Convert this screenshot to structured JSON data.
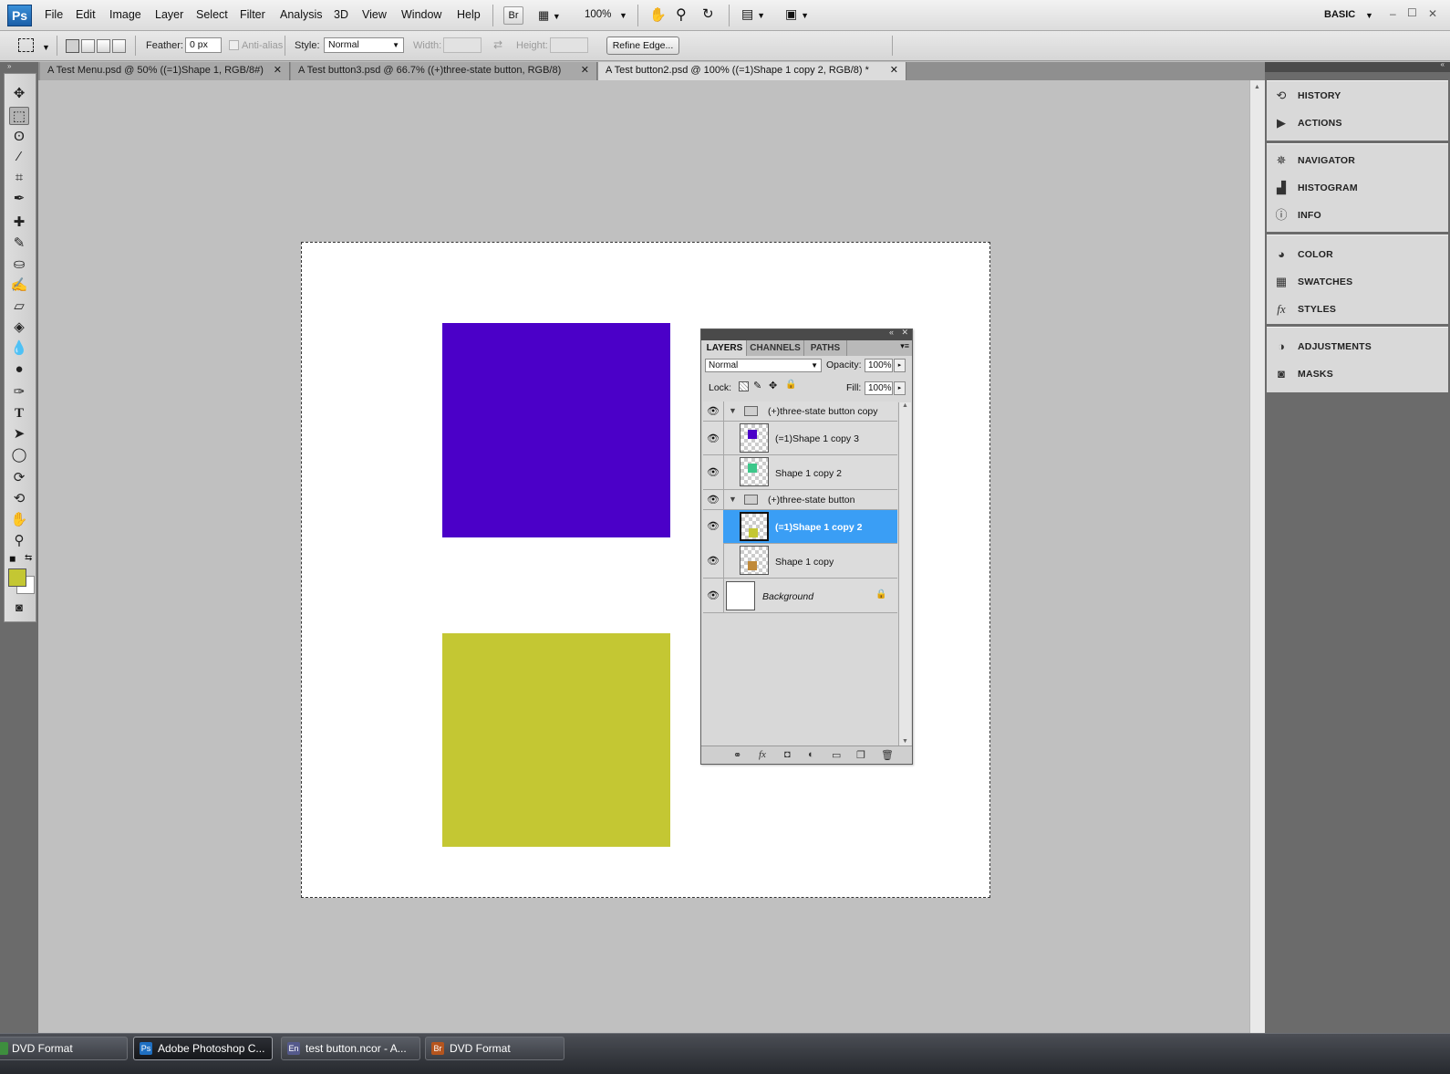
{
  "menubar": {
    "logo": "Ps",
    "menus": [
      "File",
      "Edit",
      "Image",
      "Layer",
      "Select",
      "Filter",
      "Analysis",
      "3D",
      "View",
      "Window",
      "Help"
    ],
    "bridge_label": "Br",
    "zoom": "100%",
    "workspace": "BASIC",
    "window_controls": [
      "–",
      "☐",
      "✕"
    ]
  },
  "options": {
    "feather_label": "Feather:",
    "feather_value": "0 px",
    "antialias_label": "Anti-alias",
    "style_label": "Style:",
    "style_value": "Normal",
    "width_label": "Width:",
    "height_label": "Height:",
    "refine_edge": "Refine Edge..."
  },
  "tabs": [
    {
      "label": "A Test Menu.psd @ 50% ((=1)Shape 1, RGB/8#)",
      "active": false
    },
    {
      "label": "A Test button3.psd @ 66.7% ((+)three-state button, RGB/8)",
      "active": false
    },
    {
      "label": "A Test button2.psd @ 100% ((=1)Shape 1 copy 2, RGB/8) *",
      "active": true
    }
  ],
  "canvas": {
    "square_top_color": "#4b00c8",
    "square_bottom_color": "#c4c733"
  },
  "toolbox": {
    "foreground_color": "#c4c733",
    "background_color": "#ffffff"
  },
  "layers_panel": {
    "tabs": [
      "LAYERS",
      "CHANNELS",
      "PATHS"
    ],
    "blend_mode": "Normal",
    "opacity_label": "Opacity:",
    "opacity_value": "100%",
    "lock_label": "Lock:",
    "fill_label": "Fill:",
    "fill_value": "100%",
    "layers": [
      {
        "name": "(+)three-state button copy",
        "type": "group"
      },
      {
        "name": "(=1)Shape 1 copy 3",
        "type": "layer",
        "color": "#4b00c8"
      },
      {
        "name": "Shape 1 copy 2",
        "type": "layer",
        "color": "#3cc78a"
      },
      {
        "name": "(+)three-state button",
        "type": "group"
      },
      {
        "name": "(=1)Shape 1 copy 2",
        "type": "layer",
        "color": "#c4c733",
        "selected": true
      },
      {
        "name": "Shape 1 copy",
        "type": "layer",
        "color": "#c08a3a"
      },
      {
        "name": "Background",
        "type": "background"
      }
    ],
    "bottom_icons": [
      "link-icon",
      "fx-icon",
      "mask-icon",
      "adjustment-icon",
      "folder-icon",
      "new-layer-icon",
      "trash-icon"
    ]
  },
  "dock": {
    "groups": [
      [
        "HISTORY",
        "ACTIONS"
      ],
      [
        "NAVIGATOR",
        "HISTOGRAM",
        "INFO"
      ],
      [
        "COLOR",
        "SWATCHES",
        "STYLES"
      ],
      [
        "ADJUSTMENTS",
        "MASKS"
      ]
    ]
  },
  "taskbar": {
    "items": [
      {
        "label": "DVD Format",
        "icon": "dvd-icon",
        "active": false
      },
      {
        "label": "Adobe Photoshop C...",
        "icon": "Ps",
        "active": true
      },
      {
        "label": "test button.ncor - A...",
        "icon": "En",
        "active": false
      },
      {
        "label": "DVD Format",
        "icon": "Br",
        "active": false
      }
    ]
  }
}
